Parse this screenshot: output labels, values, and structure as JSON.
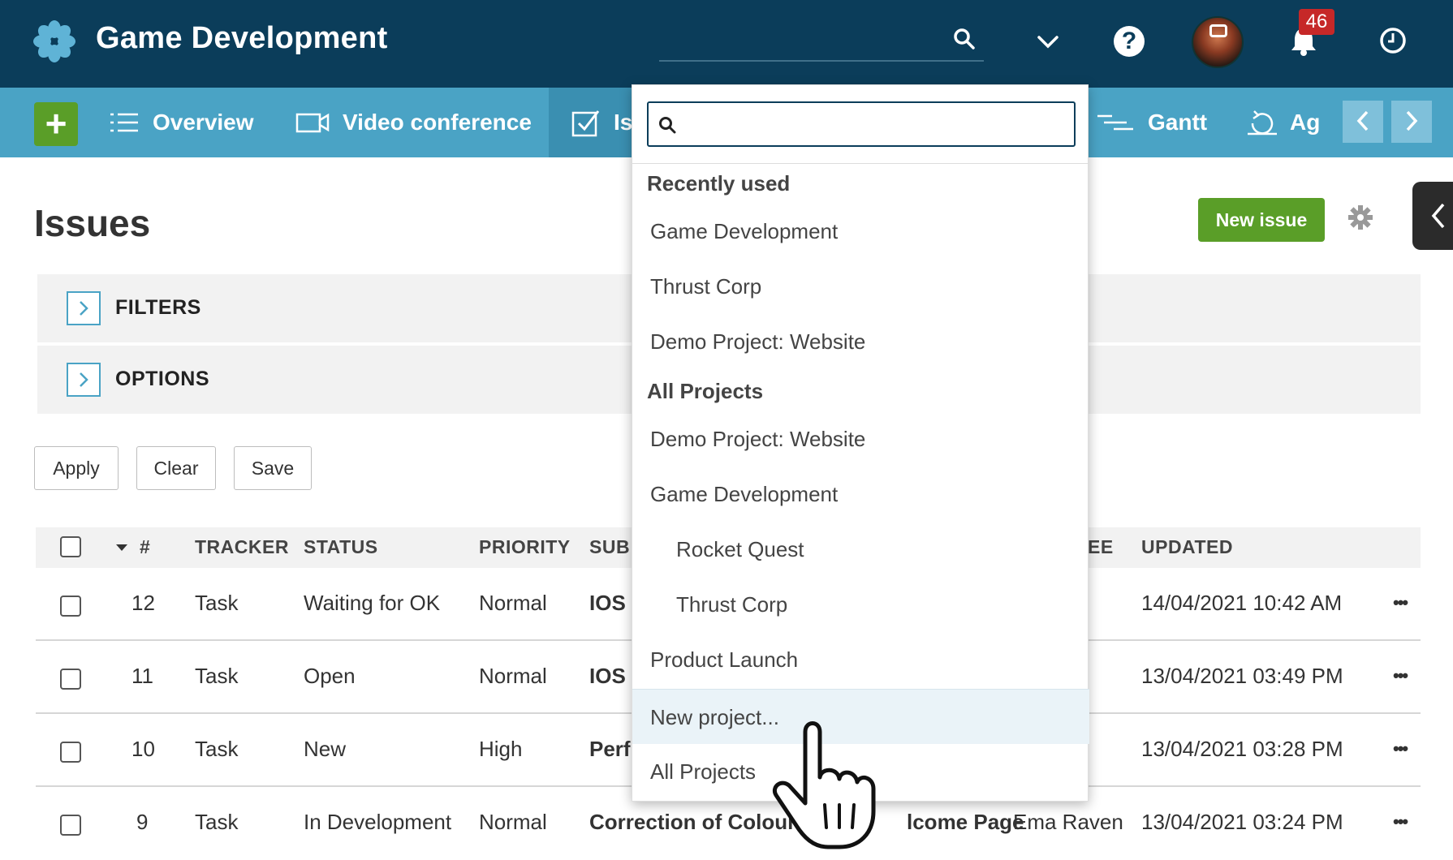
{
  "app": {
    "title": "Game Development",
    "notifications": "46"
  },
  "nav": {
    "items": [
      {
        "label": "Overview"
      },
      {
        "label": "Video conference"
      },
      {
        "label": "Is"
      },
      {
        "label": "Gantt"
      },
      {
        "label": "Ag"
      }
    ]
  },
  "page": {
    "title": "Issues",
    "new_issue": "New issue",
    "filters_label": "FILTERS",
    "options_label": "OPTIONS",
    "apply": "Apply",
    "clear": "Clear",
    "save": "Save"
  },
  "table": {
    "headers": {
      "id": "#",
      "tracker": "TRACKER",
      "status": "STATUS",
      "priority": "PRIORITY",
      "subject": "SUB",
      "assignee": "EE",
      "updated": "UPDATED"
    },
    "rows": [
      {
        "id": "12",
        "tracker": "Task",
        "status": "Waiting for OK",
        "priority": "Normal",
        "subject": "IOS",
        "assignee": "",
        "updated": "14/04/2021 10:42 AM"
      },
      {
        "id": "11",
        "tracker": "Task",
        "status": "Open",
        "priority": "Normal",
        "subject": "IOS",
        "assignee": "",
        "updated": "13/04/2021 03:49 PM"
      },
      {
        "id": "10",
        "tracker": "Task",
        "status": "New",
        "priority": "High",
        "subject": "Perf",
        "assignee": "",
        "updated": "13/04/2021 03:28 PM"
      },
      {
        "id": "9",
        "tracker": "Task",
        "status": "In Development",
        "priority": "Normal",
        "subject": "Correction of Colours",
        "subject_tail": "lcome Page",
        "assignee": "Ema Raven",
        "updated": "13/04/2021 03:24 PM"
      }
    ]
  },
  "project_menu": {
    "search_placeholder": "",
    "recent_heading": "Recently used",
    "recent": [
      "Game Development",
      "Thrust Corp",
      "Demo Project: Website"
    ],
    "all_heading": "All Projects",
    "all": [
      "Demo Project: Website",
      "Game Development",
      "Rocket Quest",
      "Thrust Corp",
      "Product Launch"
    ],
    "new_project": "New project...",
    "all_projects_link": "All Projects"
  },
  "colors": {
    "header": "#0b3d5a",
    "nav": "#4aa3c5",
    "accent_green": "#5a9e28",
    "badge": "#c62828"
  }
}
